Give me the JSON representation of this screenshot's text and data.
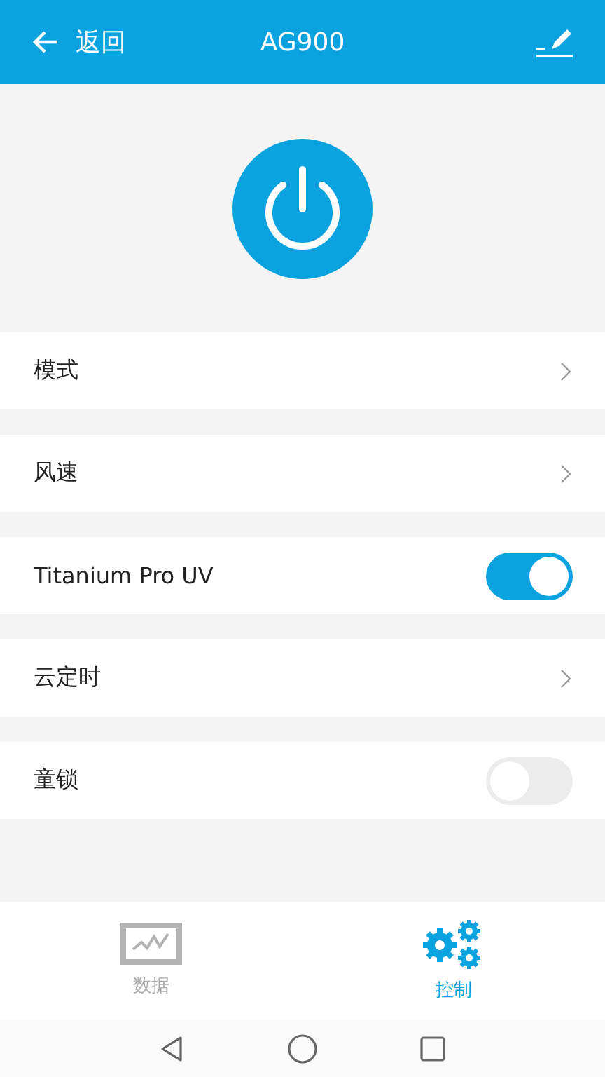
{
  "header": {
    "back_label": "返回",
    "title": "AG900"
  },
  "rows": [
    {
      "kind": "link",
      "label": "模式"
    },
    {
      "kind": "link",
      "label": "风速"
    },
    {
      "kind": "toggle",
      "label": "Titanium Pro UV",
      "on": true
    },
    {
      "kind": "link",
      "label": "云定时"
    },
    {
      "kind": "toggle",
      "label": "童锁",
      "on": false
    }
  ],
  "tabs": [
    {
      "kind": "data",
      "label": "数据",
      "selected": false
    },
    {
      "kind": "control",
      "label": "控制",
      "selected": true
    }
  ]
}
